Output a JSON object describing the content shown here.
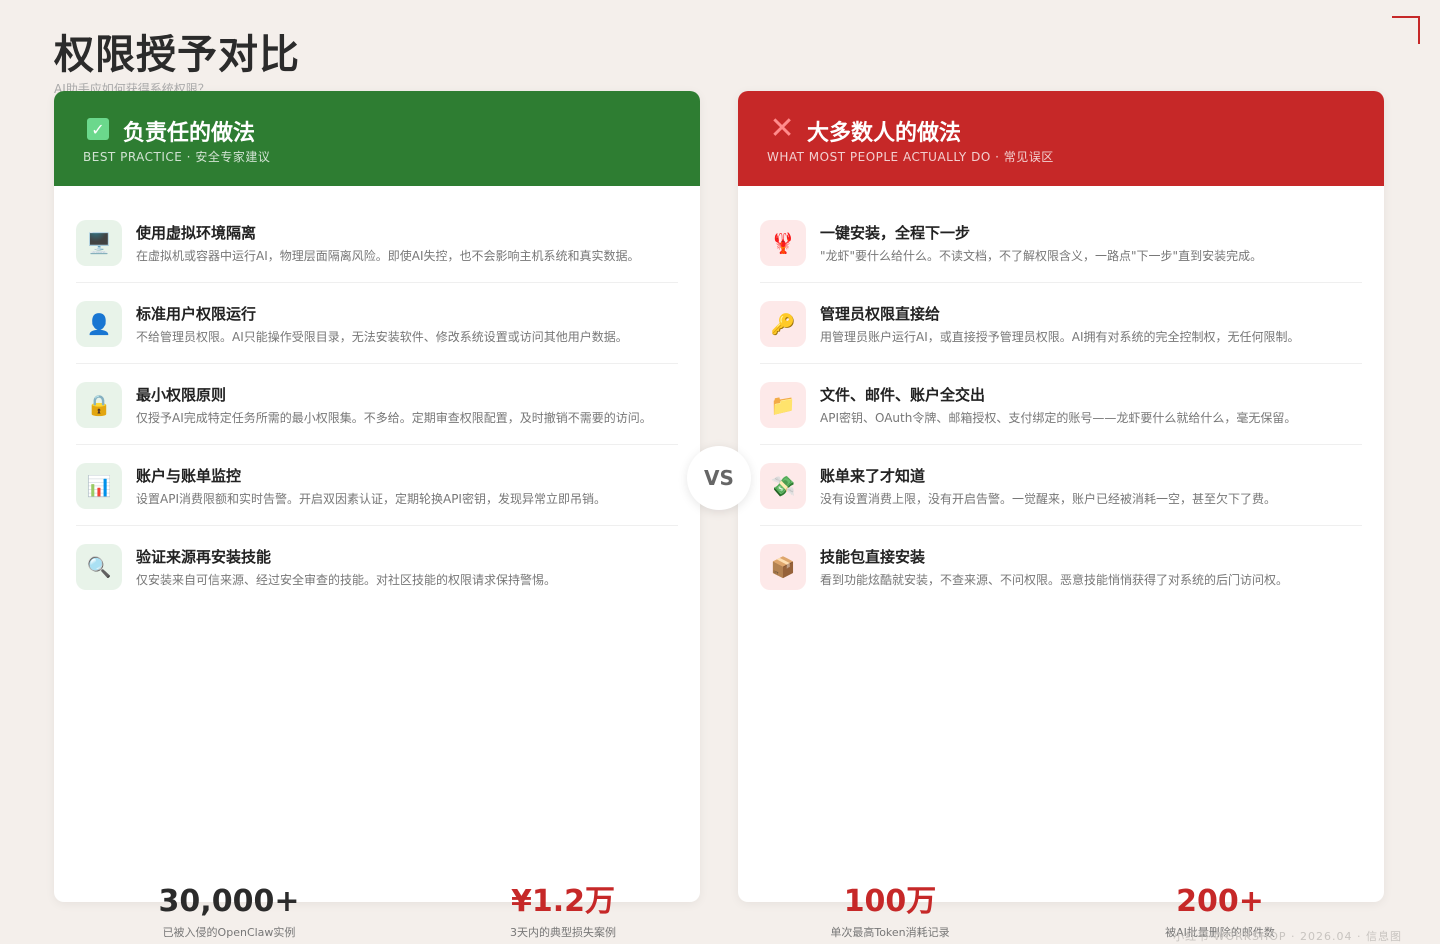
{
  "page": {
    "title": "权限授予对比",
    "subtitle": "AI助手应如何获得系统权限？"
  },
  "left": {
    "title": "负责任的做法",
    "subtitle": "BEST PRACTICE · 安全专家建议",
    "header_icon": "check-icon",
    "items": [
      {
        "icon": "🖥️",
        "icon_name": "computer-icon",
        "title": "使用虚拟环境隔离",
        "desc": "在虚拟机或容器中运行AI，物理层面隔离风险。即使AI失控，也不会影响主机系统和真实数据。"
      },
      {
        "icon": "👤",
        "icon_name": "user-icon",
        "title": "标准用户权限运行",
        "desc": "不给管理员权限。AI只能操作受限目录，无法安装软件、修改系统设置或访问其他用户数据。"
      },
      {
        "icon": "🔒",
        "icon_name": "lock-icon",
        "title": "最小权限原则",
        "desc": "仅授予AI完成特定任务所需的最小权限集。不多给。定期审查权限配置，及时撤销不需要的访问。"
      },
      {
        "icon": "📊",
        "icon_name": "chart-icon",
        "title": "账户与账单监控",
        "desc": "设置API消费限额和实时告警。开启双因素认证，定期轮换API密钥，发现异常立即吊销。"
      },
      {
        "icon": "🔍",
        "icon_name": "magnifier-icon",
        "title": "验证来源再安装技能",
        "desc": "仅安装来自可信来源、经过安全审查的技能。对社区技能的权限请求保持警惕。"
      }
    ]
  },
  "right": {
    "title": "大多数人的做法",
    "subtitle": "WHAT MOST PEOPLE ACTUALLY DO · 常见误区",
    "header_icon": "cross-icon",
    "items": [
      {
        "icon": "🦞",
        "icon_name": "lobster-icon",
        "title": "一键安装，全程下一步",
        "desc": "\"龙虾\"要什么给什么。不读文档，不了解权限含义，一路点\"下一步\"直到安装完成。"
      },
      {
        "icon": "🔑",
        "icon_name": "key-icon",
        "title": "管理员权限直接给",
        "desc": "用管理员账户运行AI，或直接授予管理员权限。AI拥有对系统的完全控制权，无任何限制。"
      },
      {
        "icon": "📁",
        "icon_name": "folder-icon",
        "title": "文件、邮件、账户全交出",
        "desc": "API密钥、OAuth令牌、邮箱授权、支付绑定的账号——龙虾要什么就给什么，毫无保留。"
      },
      {
        "icon": "💸",
        "icon_name": "money-icon",
        "title": "账单来了才知道",
        "desc": "没有设置消费上限，没有开启告警。一觉醒来，账户已经被消耗一空，甚至欠下了费。"
      },
      {
        "icon": "📦",
        "icon_name": "package-icon",
        "title": "技能包直接安装",
        "desc": "看到功能炫酷就安装，不查来源、不问权限。恶意技能悄悄获得了对系统的后门访问权。"
      }
    ]
  },
  "vs_label": "VS",
  "stats": [
    {
      "value": "30,000+",
      "label": "已被入侵的OpenClaw实例",
      "tone": "dark"
    },
    {
      "value": "¥1.2万",
      "label": "3天内的典型损失案例",
      "tone": "red"
    },
    {
      "value": "100万",
      "label": "单次最高Token消耗记录",
      "tone": "red"
    },
    {
      "value": "200+",
      "label": "被AI批量删除的邮件数",
      "tone": "red"
    }
  ],
  "footer": "小红书 WORKSHOP · 2026.04 · 信息图",
  "colors": {
    "good": "#2e7d32",
    "bad": "#c62828",
    "background": "#f4efeb"
  }
}
